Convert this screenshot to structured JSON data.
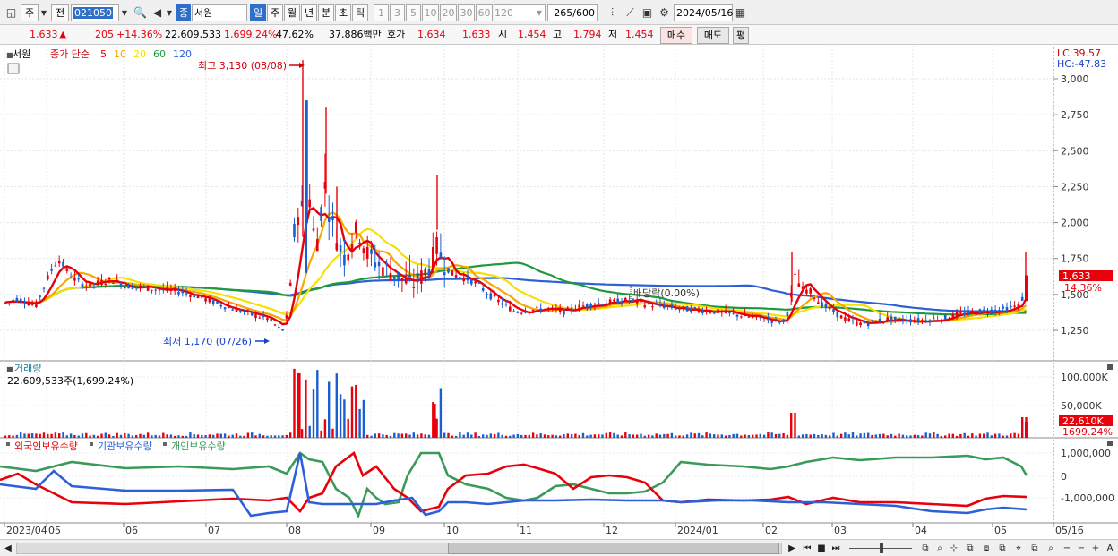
{
  "toolbar": {
    "ju_label": "주",
    "jeon_label": "전",
    "stock_code": "021050",
    "jong_badge": "종",
    "stock_name": "서원",
    "period_tabs": [
      "일",
      "주",
      "월",
      "년",
      "분",
      "초",
      "틱"
    ],
    "interval_tabs": [
      "1",
      "3",
      "5",
      "10",
      "20",
      "30",
      "60",
      "120"
    ],
    "count_value": "265",
    "count_total": "/600",
    "date_value": "2024/05/16"
  },
  "info": {
    "price": "1,633",
    "arrow": "▲",
    "change": "205",
    "change_pct": "+14.36%",
    "volume": "22,609,533",
    "volume_pct": "1,699.24%",
    "turnover_pct": "47.62%",
    "amount": "37,886백만",
    "hoga_label": "호가",
    "hoga1": "1,634",
    "hoga2": "1,633",
    "open_label": "시",
    "open": "1,454",
    "high_label": "고",
    "high": "1,794",
    "low_label": "저",
    "low": "1,454",
    "buy_btn": "매수",
    "sell_btn": "매도",
    "extra_btn": "평"
  },
  "price_panel": {
    "name_label": "서원",
    "ma_label": "종가 단순",
    "ma_periods": [
      "5",
      "10",
      "20",
      "60",
      "120"
    ],
    "ma_colors": [
      "#e8000b",
      "#f5a800",
      "#f5e000",
      "#1e9a3c",
      "#2c5fd8"
    ],
    "lc_label": "LC:39.57",
    "hc_label": "HC:-47.83",
    "high_note": "최고 3,130 (08/08)",
    "low_note": "최저 1,170 (07/26)",
    "dividend_note": "배당락(0.00%)",
    "last_price_tag": "1,633",
    "last_pct_tag": "14.36%",
    "y_ticks": [
      "3,000",
      "2,750",
      "2,500",
      "2,250",
      "2,000",
      "1,750",
      "1,500",
      "1,250"
    ]
  },
  "volume_panel": {
    "title": "거래량",
    "value_text": "22,609,533주(1,699.24%)",
    "y_ticks": [
      "100,000K",
      "50,000K"
    ],
    "last_tag": "22,610K",
    "last_pct": "1699.24%"
  },
  "holdings_panel": {
    "series_labels": [
      "외국인보유수량",
      "기관보유수량",
      "개인보유수량"
    ],
    "series_colors": [
      "#e8000b",
      "#2c5fd8",
      "#3a9a5a"
    ],
    "y_ticks": [
      "1,000,000",
      "0",
      "-1,000,000"
    ]
  },
  "x_axis": {
    "labels": [
      "2023/04",
      "05",
      "06",
      "07",
      "08",
      "09",
      "10",
      "11",
      "12",
      "2024/01",
      "02",
      "03",
      "04",
      "05",
      "05/16"
    ]
  },
  "chart_data": {
    "type": "candlestick",
    "price_range": [
      1150,
      3200
    ],
    "highest": {
      "value": 3130,
      "date": "08/08"
    },
    "lowest": {
      "value": 1170,
      "date": "07/26"
    },
    "last": {
      "price": 1633,
      "change_pct": 14.36
    }
  }
}
